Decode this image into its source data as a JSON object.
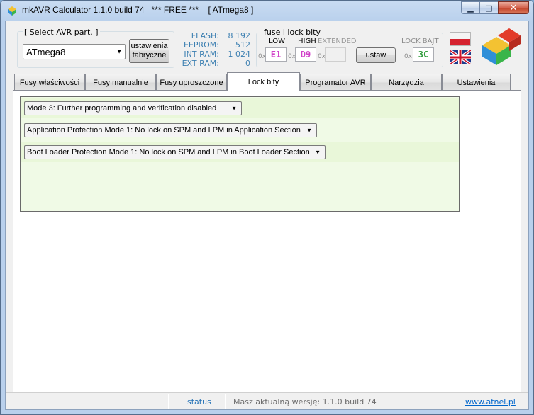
{
  "window": {
    "title": "mkAVR Calculator 1.1.0 build 74   *** FREE ***    [ ATmega8 ]",
    "minimize_glyph": "▁",
    "maximize_glyph": "□",
    "close_glyph": "✕",
    "app_icon": "cube-icon"
  },
  "avr_part": {
    "group_label": "[ Select AVR part. ]",
    "selected": "ATmega8",
    "factory_button_line1": "ustawienia",
    "factory_button_line2": "fabryczne"
  },
  "memory": {
    "flash_label": "FLASH:",
    "flash_value": "8 192",
    "eeprom_label": "EEPROM:",
    "eeprom_value": "512",
    "intram_label": "INT RAM:",
    "intram_value": "1 024",
    "extram_label": "EXT RAM:",
    "extram_value": "0"
  },
  "fuses": {
    "group_label": "fuse i lock bity",
    "low_label": "LOW",
    "high_label": "HIGH",
    "extended_label": "EXTENDED",
    "lock_label": "LOCK BAJT",
    "hex_prefix": "0x",
    "low_value": "E1",
    "high_value": "D9",
    "extended_value": "",
    "lock_value": "3C",
    "set_button": "ustaw"
  },
  "languages": [
    "polish-flag-icon",
    "uk-flag-icon"
  ],
  "logo": "atnel-logo-icon",
  "tabs": [
    {
      "label": "Fusy właściwości",
      "active": false
    },
    {
      "label": "Fusy manualnie",
      "active": false
    },
    {
      "label": "Fusy uproszczone",
      "active": false
    },
    {
      "label": "Lock bity",
      "active": true
    },
    {
      "label": "Programator AVR",
      "active": false
    },
    {
      "label": "Narzędzia",
      "active": false
    },
    {
      "label": "Ustawienia",
      "active": false
    }
  ],
  "lock_bits": {
    "mode": "Mode 3: Further programming and verification disabled",
    "app_protection": "Application Protection Mode 1: No lock on SPM and LPM in Application Section",
    "boot_protection": "Boot Loader Protection Mode 1: No lock on SPM and LPM in Boot Loader Section"
  },
  "status": {
    "label": "status",
    "version_text": "Masz aktualną wersję: 1.1.0 build 74",
    "link": "www.atnel.pl"
  },
  "colors": {
    "memory_blue": "#3c7fb1",
    "low_fuse": "#d040c8",
    "high_fuse": "#d040c8",
    "lock_fuse": "#2e9b3a",
    "lock_panel_bg": "#f0fae6",
    "link": "#0066cc"
  }
}
